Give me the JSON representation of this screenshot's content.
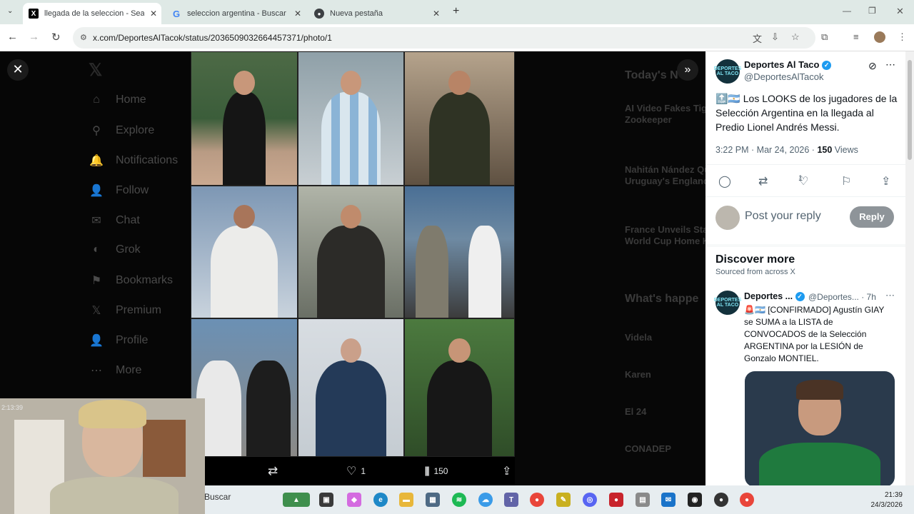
{
  "browser": {
    "tabs": [
      {
        "title": "llegada de la seleccion - Search",
        "favicon": "x-logo"
      },
      {
        "title": "seleccion argentina - Buscar con",
        "favicon": "google-g"
      },
      {
        "title": "Nueva pestaña",
        "favicon": "chrome-logo"
      }
    ],
    "new_tab": "+",
    "url": "x.com/DeportesAlTacok/status/2036509032664457371/photo/1"
  },
  "sidebar": {
    "items": [
      {
        "label": "Home",
        "icon": "home-icon",
        "glyph": "⌂"
      },
      {
        "label": "Explore",
        "icon": "search-icon",
        "glyph": "⚲"
      },
      {
        "label": "Notifications",
        "icon": "bell-icon",
        "glyph": "🔔"
      },
      {
        "label": "Follow",
        "icon": "follow-icon",
        "glyph": "👤"
      },
      {
        "label": "Chat",
        "icon": "mail-icon",
        "glyph": "✉"
      },
      {
        "label": "Grok",
        "icon": "grok-icon",
        "glyph": "◐"
      },
      {
        "label": "Bookmarks",
        "icon": "bookmark-icon",
        "glyph": "⚑"
      },
      {
        "label": "Premium",
        "icon": "x-icon",
        "glyph": "𝕏"
      },
      {
        "label": "Profile",
        "icon": "profile-icon",
        "glyph": "👤"
      },
      {
        "label": "More",
        "icon": "more-icon",
        "glyph": "⋯"
      }
    ]
  },
  "background": {
    "todays_news": "Today's N",
    "news": [
      "AI Video Fakes Tige",
      "Zookeeper",
      "Nahitán Nández Qu",
      "Uruguay's England",
      "France Unveils Sta",
      "World Cup Home K"
    ],
    "whats_happening": "What's happe",
    "trends": [
      "Videla",
      "Karen",
      "El 24",
      "CONADEP"
    ]
  },
  "photo_bar": {
    "likes": "1",
    "views": "150"
  },
  "tweet": {
    "author_name": "Deportes Al Taco",
    "author_handle": "@DeportesAlTacok",
    "avatar_text": "DEPORTES AL TACO",
    "text": "🔝🇦🇷 Los LOOKS de los jugadores de la Selección Argentina en la llegada al Predio Lionel Andrés Messi.",
    "time": "3:22 PM · Mar 24, 2026 · ",
    "views": "150",
    "views_label": " Views",
    "likes": "1"
  },
  "reply": {
    "placeholder": "Post your reply",
    "button": "Reply"
  },
  "discover": {
    "title": "Discover more",
    "subtitle": "Sourced from across X",
    "post": {
      "author_name": "Deportes ...",
      "handle_time": "@Deportes... · 7h",
      "text": "🚨🇦🇷 [CONFIRMADO] Agustín GIAY se SUMA a la LISTA de CONVOCADOS de la Selección ARGENTINA por la LESIÓN de Gonzalo MONTIEL."
    }
  },
  "taskbar": {
    "search": "Buscar",
    "time": "21:39",
    "date": "24/3/2026"
  },
  "webcam": {
    "timestamp": "2:13:39"
  }
}
